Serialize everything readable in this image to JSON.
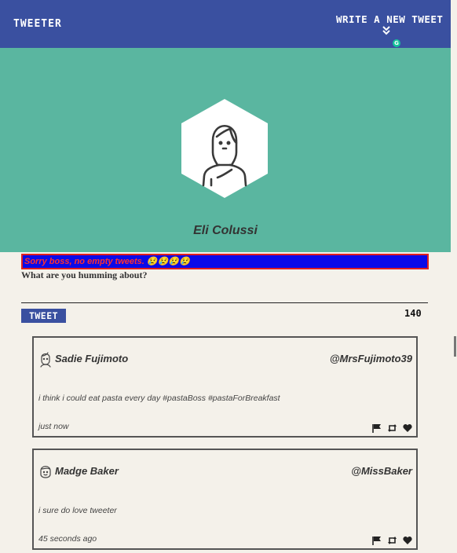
{
  "nav": {
    "brand": "TWEETER",
    "compose_label": "WRITE A NEW TWEET"
  },
  "profile": {
    "name": "Eli Colussi"
  },
  "composer": {
    "error_message": "Sorry boss, no empty tweets. 😢😢😢😢",
    "prompt": "What are you humming about?",
    "submit_label": "TWEET",
    "counter": "140"
  },
  "tweets": [
    {
      "name": "Sadie Fujimoto",
      "handle": "@MrsFujimoto39",
      "text": "i think i could eat pasta every day #pastaBoss #pastaForBreakfast",
      "time": "just now"
    },
    {
      "name": "Madge Baker",
      "handle": "@MissBaker",
      "text": "i sure do love tweeter",
      "time": "45 seconds ago"
    }
  ],
  "colors": {
    "nav": "#3a50a0",
    "hero": "#5ab6a0",
    "background": "#f4f1ea",
    "error_bg": "#0a0ae8",
    "error_text": "#ff3030"
  }
}
